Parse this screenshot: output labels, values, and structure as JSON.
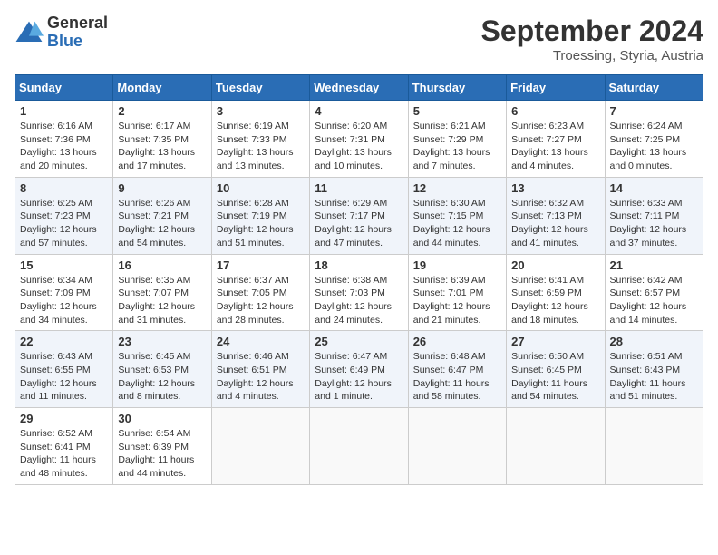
{
  "header": {
    "logo_general": "General",
    "logo_blue": "Blue",
    "month_title": "September 2024",
    "location": "Troessing, Styria, Austria"
  },
  "weekdays": [
    "Sunday",
    "Monday",
    "Tuesday",
    "Wednesday",
    "Thursday",
    "Friday",
    "Saturday"
  ],
  "weeks": [
    [
      {
        "day": "1",
        "info": "Sunrise: 6:16 AM\nSunset: 7:36 PM\nDaylight: 13 hours\nand 20 minutes."
      },
      {
        "day": "2",
        "info": "Sunrise: 6:17 AM\nSunset: 7:35 PM\nDaylight: 13 hours\nand 17 minutes."
      },
      {
        "day": "3",
        "info": "Sunrise: 6:19 AM\nSunset: 7:33 PM\nDaylight: 13 hours\nand 13 minutes."
      },
      {
        "day": "4",
        "info": "Sunrise: 6:20 AM\nSunset: 7:31 PM\nDaylight: 13 hours\nand 10 minutes."
      },
      {
        "day": "5",
        "info": "Sunrise: 6:21 AM\nSunset: 7:29 PM\nDaylight: 13 hours\nand 7 minutes."
      },
      {
        "day": "6",
        "info": "Sunrise: 6:23 AM\nSunset: 7:27 PM\nDaylight: 13 hours\nand 4 minutes."
      },
      {
        "day": "7",
        "info": "Sunrise: 6:24 AM\nSunset: 7:25 PM\nDaylight: 13 hours\nand 0 minutes."
      }
    ],
    [
      {
        "day": "8",
        "info": "Sunrise: 6:25 AM\nSunset: 7:23 PM\nDaylight: 12 hours\nand 57 minutes."
      },
      {
        "day": "9",
        "info": "Sunrise: 6:26 AM\nSunset: 7:21 PM\nDaylight: 12 hours\nand 54 minutes."
      },
      {
        "day": "10",
        "info": "Sunrise: 6:28 AM\nSunset: 7:19 PM\nDaylight: 12 hours\nand 51 minutes."
      },
      {
        "day": "11",
        "info": "Sunrise: 6:29 AM\nSunset: 7:17 PM\nDaylight: 12 hours\nand 47 minutes."
      },
      {
        "day": "12",
        "info": "Sunrise: 6:30 AM\nSunset: 7:15 PM\nDaylight: 12 hours\nand 44 minutes."
      },
      {
        "day": "13",
        "info": "Sunrise: 6:32 AM\nSunset: 7:13 PM\nDaylight: 12 hours\nand 41 minutes."
      },
      {
        "day": "14",
        "info": "Sunrise: 6:33 AM\nSunset: 7:11 PM\nDaylight: 12 hours\nand 37 minutes."
      }
    ],
    [
      {
        "day": "15",
        "info": "Sunrise: 6:34 AM\nSunset: 7:09 PM\nDaylight: 12 hours\nand 34 minutes."
      },
      {
        "day": "16",
        "info": "Sunrise: 6:35 AM\nSunset: 7:07 PM\nDaylight: 12 hours\nand 31 minutes."
      },
      {
        "day": "17",
        "info": "Sunrise: 6:37 AM\nSunset: 7:05 PM\nDaylight: 12 hours\nand 28 minutes."
      },
      {
        "day": "18",
        "info": "Sunrise: 6:38 AM\nSunset: 7:03 PM\nDaylight: 12 hours\nand 24 minutes."
      },
      {
        "day": "19",
        "info": "Sunrise: 6:39 AM\nSunset: 7:01 PM\nDaylight: 12 hours\nand 21 minutes."
      },
      {
        "day": "20",
        "info": "Sunrise: 6:41 AM\nSunset: 6:59 PM\nDaylight: 12 hours\nand 18 minutes."
      },
      {
        "day": "21",
        "info": "Sunrise: 6:42 AM\nSunset: 6:57 PM\nDaylight: 12 hours\nand 14 minutes."
      }
    ],
    [
      {
        "day": "22",
        "info": "Sunrise: 6:43 AM\nSunset: 6:55 PM\nDaylight: 12 hours\nand 11 minutes."
      },
      {
        "day": "23",
        "info": "Sunrise: 6:45 AM\nSunset: 6:53 PM\nDaylight: 12 hours\nand 8 minutes."
      },
      {
        "day": "24",
        "info": "Sunrise: 6:46 AM\nSunset: 6:51 PM\nDaylight: 12 hours\nand 4 minutes."
      },
      {
        "day": "25",
        "info": "Sunrise: 6:47 AM\nSunset: 6:49 PM\nDaylight: 12 hours\nand 1 minute."
      },
      {
        "day": "26",
        "info": "Sunrise: 6:48 AM\nSunset: 6:47 PM\nDaylight: 11 hours\nand 58 minutes."
      },
      {
        "day": "27",
        "info": "Sunrise: 6:50 AM\nSunset: 6:45 PM\nDaylight: 11 hours\nand 54 minutes."
      },
      {
        "day": "28",
        "info": "Sunrise: 6:51 AM\nSunset: 6:43 PM\nDaylight: 11 hours\nand 51 minutes."
      }
    ],
    [
      {
        "day": "29",
        "info": "Sunrise: 6:52 AM\nSunset: 6:41 PM\nDaylight: 11 hours\nand 48 minutes."
      },
      {
        "day": "30",
        "info": "Sunrise: 6:54 AM\nSunset: 6:39 PM\nDaylight: 11 hours\nand 44 minutes."
      },
      {
        "day": "",
        "info": ""
      },
      {
        "day": "",
        "info": ""
      },
      {
        "day": "",
        "info": ""
      },
      {
        "day": "",
        "info": ""
      },
      {
        "day": "",
        "info": ""
      }
    ]
  ]
}
